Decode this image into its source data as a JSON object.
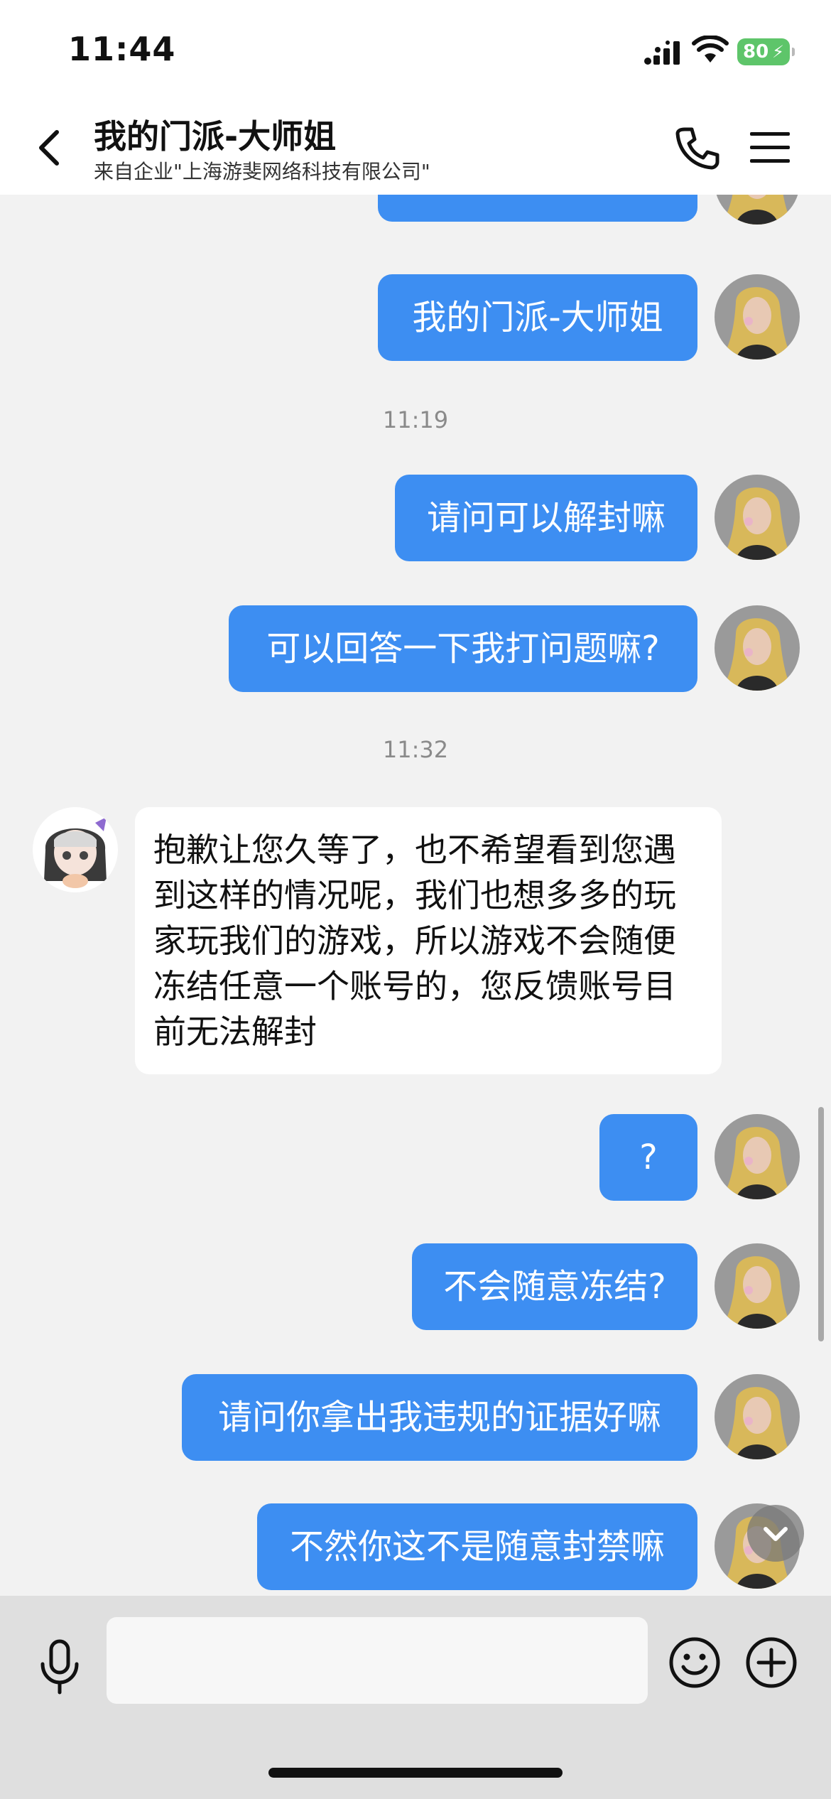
{
  "status_bar": {
    "time": "11:44",
    "battery": "80"
  },
  "header": {
    "title": "我的门派-大师姐",
    "subtitle": "来自企业\"上海游斐网络科技有限公司\""
  },
  "messages": [
    {
      "type": "out",
      "text": "我的门派-大师姐"
    },
    {
      "type": "out",
      "text": "我的门派-大师姐"
    },
    {
      "type": "time",
      "text": "11:19"
    },
    {
      "type": "out",
      "text": "请问可以解封嘛"
    },
    {
      "type": "out",
      "text": "可以回答一下我打问题嘛?"
    },
    {
      "type": "time",
      "text": "11:32"
    },
    {
      "type": "in",
      "text": "抱歉让您久等了，也不希望看到您遇到这样的情况呢，我们也想多多的玩家玩我们的游戏，所以游戏不会随便冻结任意一个账号的，您反馈账号目前无法解封"
    },
    {
      "type": "out",
      "text": "?"
    },
    {
      "type": "out",
      "text": "不会随意冻结?"
    },
    {
      "type": "out",
      "text": "请问你拿出我违规的证据好嘛"
    },
    {
      "type": "out",
      "text": "不然你这不是随意封禁嘛"
    }
  ],
  "input": {
    "placeholder": ""
  },
  "colors": {
    "bubble_out": "#3d8ef2",
    "bubble_in": "#ffffff",
    "background": "#f2f2f2",
    "battery": "#5ec56a"
  },
  "icons": [
    "back-icon",
    "phone-icon",
    "menu-icon",
    "mic-icon",
    "emoji-icon",
    "plus-icon",
    "chevron-down-icon",
    "signal-icon",
    "wifi-icon"
  ]
}
